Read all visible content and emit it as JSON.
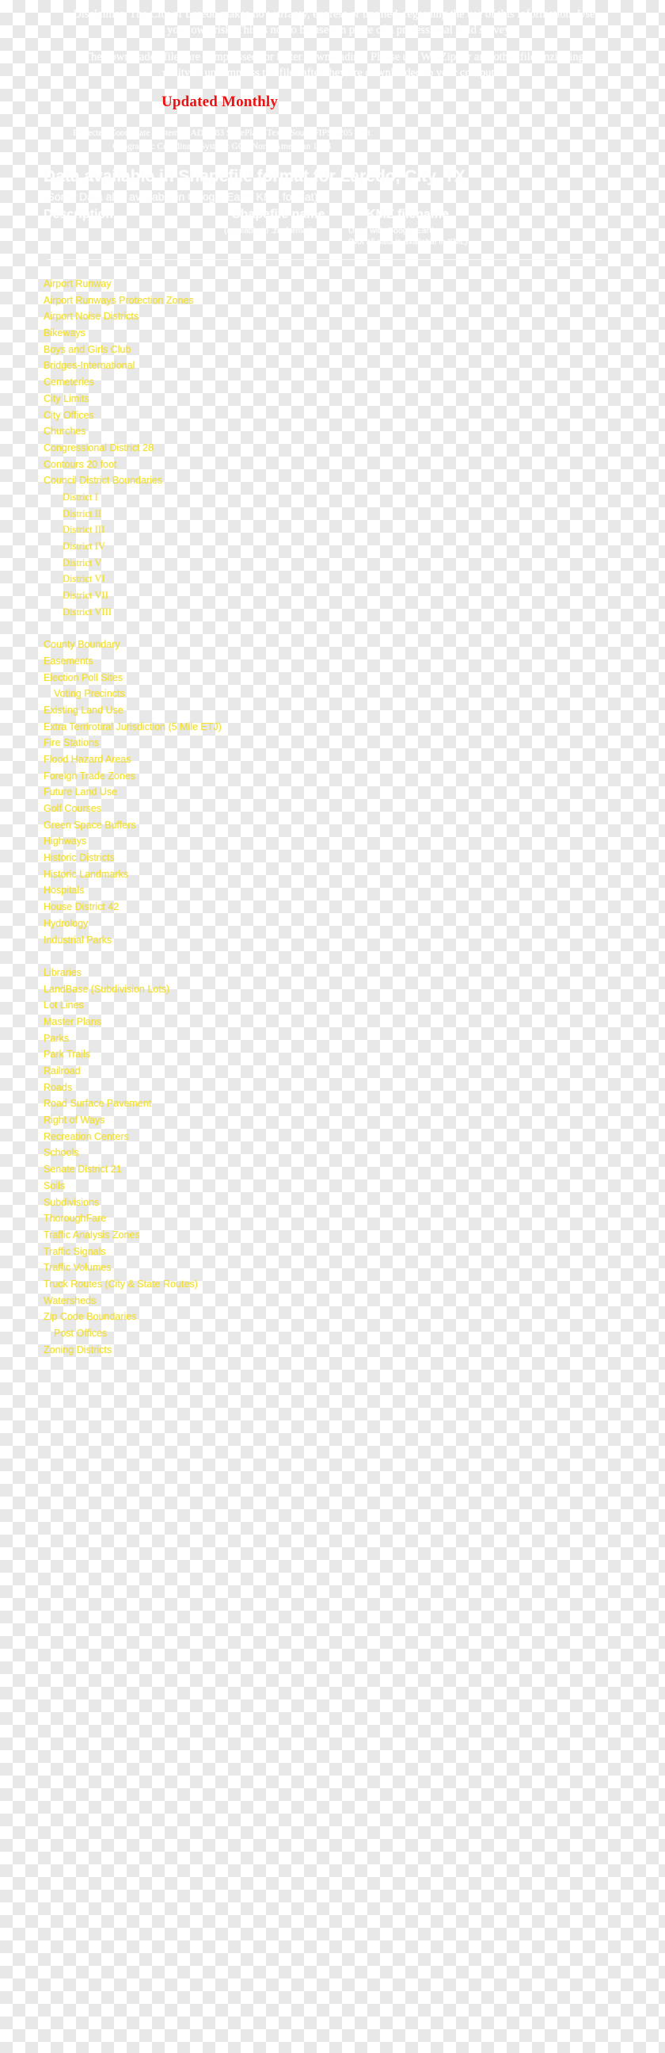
{
  "header": {
    "disclaimer": "Disclaimer: The City of Laredo makes no warranty, express or implied, regarding the use of this information. Use at your own risk. This is not to be used in place of a professional field survey.",
    "zip_note": "The downloaded files are compressed for faster downloading. Please use WinZip, or any other file unzipping utility to uncompress the files after they are downloaded to your computer.",
    "updated_monthly": "Updated Monthly",
    "projected_coordinate_system": "Projected Coordinate System: NAD 1983 StatePlane Texas South FIPS 4205 Feet",
    "geographic_coordinate_system": "Geographic Coordinate System: GCS North American 1983",
    "availability_title": "Data available in Shapefile format for Laredo, City, TX",
    "availability_subtitle": "(Some Data also available in Google Earth KMZ format)"
  },
  "table_headers": {
    "description": "Description",
    "shapefile_name": "Shapefile name",
    "shapefile_note": "(available in .zip format)",
    "kmz_filename": "KMZ filename",
    "kmz_note_line1": "Used with Google Earth",
    "kmz_note_line2": "(Not all data is available in KML)"
  },
  "colors": {
    "link": "#f2e035",
    "heading_red": "#ee1111",
    "ghost_text": "#fdfdfd"
  },
  "links": [
    {
      "label": "Airport Runway",
      "indent": 0
    },
    {
      "label": "Airport Runways Protection Zones",
      "indent": 0
    },
    {
      "label": "Airport Noise Districts",
      "indent": 0
    },
    {
      "label": "Bikeways",
      "indent": 0
    },
    {
      "label": "Boys and Girls Club",
      "indent": 0
    },
    {
      "label": "Bridges-International",
      "indent": 0
    },
    {
      "label": "Cemeteries",
      "indent": 0
    },
    {
      "label": "City Limits",
      "indent": 0
    },
    {
      "label": "City Offices",
      "indent": 0
    },
    {
      "label": "Churches",
      "indent": 0
    },
    {
      "label": "Congressional District 28",
      "indent": 0
    },
    {
      "label": "Contours 20 foot",
      "indent": 0
    },
    {
      "label": "Council District Boundaries",
      "indent": 0
    },
    {
      "label": "District I",
      "indent": 2
    },
    {
      "label": "District II",
      "indent": 2
    },
    {
      "label": "District III",
      "indent": 2
    },
    {
      "label": "District IV",
      "indent": 2
    },
    {
      "label": "District V",
      "indent": 2
    },
    {
      "label": "District VI",
      "indent": 2
    },
    {
      "label": "District VII",
      "indent": 2
    },
    {
      "label": "District VIII",
      "indent": 2
    },
    {
      "label": "",
      "indent": 0,
      "spacer": true
    },
    {
      "label": "County Boundary",
      "indent": 0
    },
    {
      "label": "Easements",
      "indent": 0
    },
    {
      "label": "Election Poll Sites",
      "indent": 0
    },
    {
      "label": "Voting Precincts",
      "indent": 1
    },
    {
      "label": "Existing Land Use",
      "indent": 0
    },
    {
      "label": "Extra Terrirotiral Jurisdiction (5 Mile ETJ)",
      "indent": 0
    },
    {
      "label": "Fire Stations",
      "indent": 0
    },
    {
      "label": "Flood Hazard Areas",
      "indent": 0
    },
    {
      "label": "Foreign Trade Zones",
      "indent": 0
    },
    {
      "label": "Future Land Use",
      "indent": 0
    },
    {
      "label": "Golf Courses",
      "indent": 0
    },
    {
      "label": "Green Space Buffers",
      "indent": 0
    },
    {
      "label": "Highways",
      "indent": 0
    },
    {
      "label": "Historic Districts",
      "indent": 0
    },
    {
      "label": "Historic Landmarks",
      "indent": 0
    },
    {
      "label": "Hospitals",
      "indent": 0
    },
    {
      "label": "House District 42",
      "indent": 0
    },
    {
      "label": "Hydrology",
      "indent": 0
    },
    {
      "label": "Industrial Parks",
      "indent": 0
    },
    {
      "label": "",
      "indent": 0,
      "spacer": true
    },
    {
      "label": "Libraries",
      "indent": 0
    },
    {
      "label": "LandBase (Subdivision Lots)",
      "indent": 0
    },
    {
      "label": "Lot Lines",
      "indent": 0
    },
    {
      "label": "Master Plans",
      "indent": 0
    },
    {
      "label": "Parks",
      "indent": 0
    },
    {
      "label": "Park Trails",
      "indent": 0
    },
    {
      "label": "Railroad",
      "indent": 0
    },
    {
      "label": "Roads",
      "indent": 0
    },
    {
      "label": "Road Surface Pavement",
      "indent": 0
    },
    {
      "label": "Right of Ways",
      "indent": 0
    },
    {
      "label": "Recreation Centers",
      "indent": 0
    },
    {
      "label": "Schools",
      "indent": 0
    },
    {
      "label": "Senate District 21",
      "indent": 0
    },
    {
      "label": "Soils",
      "indent": 0
    },
    {
      "label": "Subdivisions",
      "indent": 0
    },
    {
      "label": "ThoroughFare",
      "indent": 0
    },
    {
      "label": "Traffic Analysis Zones",
      "indent": 0
    },
    {
      "label": "Traffic Signals",
      "indent": 0
    },
    {
      "label": "Traffic Volumes",
      "indent": 0
    },
    {
      "label": "Truck Routes (City & State Routes)",
      "indent": 0
    },
    {
      "label": "Watersheds",
      "indent": 0
    },
    {
      "label": "Zip Code Boundaries",
      "indent": 0
    },
    {
      "label": "Post Offices",
      "indent": 1
    },
    {
      "label": "Zoning Districts",
      "indent": 0
    }
  ]
}
